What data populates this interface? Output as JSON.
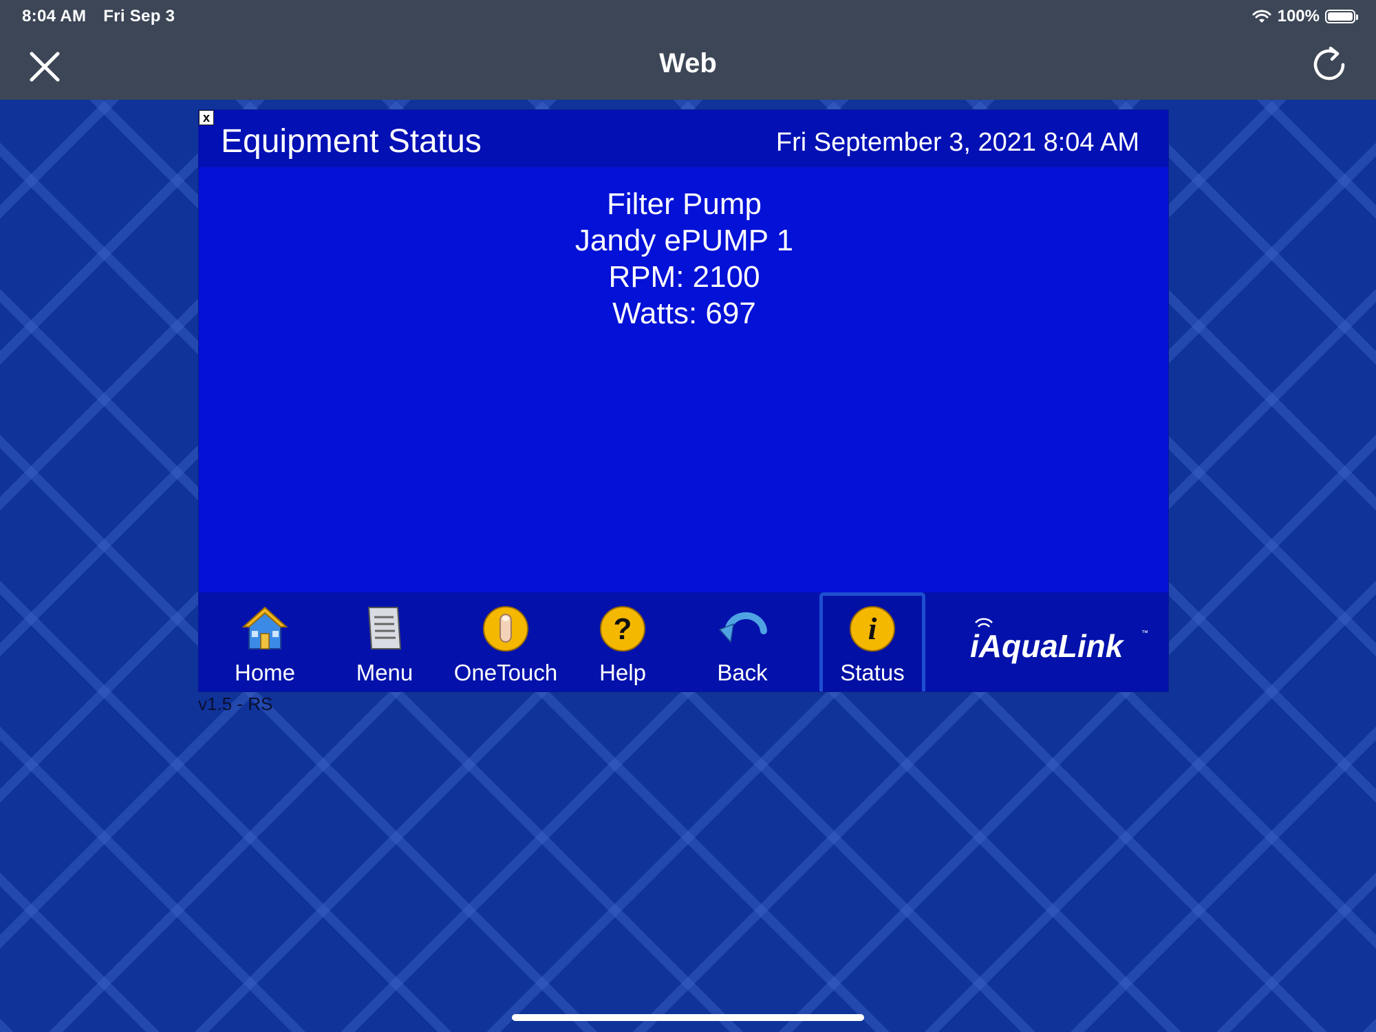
{
  "status_bar": {
    "time": "8:04 AM",
    "date": "Fri Sep 3",
    "battery": "100%",
    "icons": [
      "wifi-icon",
      "battery-icon"
    ]
  },
  "nav_bar": {
    "title": "Web",
    "icons": [
      "close-icon",
      "reload-icon"
    ]
  },
  "panel": {
    "close_label": "x",
    "title": "Equipment Status",
    "datetime": "Fri September 3, 2021 8:04 AM",
    "details": [
      "Filter Pump",
      "Jandy ePUMP 1",
      "RPM: 2100",
      "Watts: 697"
    ]
  },
  "toolbar": {
    "buttons": [
      {
        "label": "Home",
        "icon": "home-icon"
      },
      {
        "label": "Menu",
        "icon": "menu-icon"
      },
      {
        "label": "OneTouch",
        "icon": "onetouch-icon"
      },
      {
        "label": "Help",
        "icon": "help-icon"
      },
      {
        "label": "Back",
        "icon": "back-icon"
      },
      {
        "label": "Status",
        "icon": "status-icon",
        "active": true
      }
    ],
    "brand": "iAquaLink"
  },
  "footer": {
    "version": "v1.5 - RS"
  },
  "colors": {
    "panel_bg": "#0411d6",
    "header_bg": "#0310b4",
    "toolbar_bg": "#0412ab",
    "page_bg": "#10339a",
    "topbar_bg": "#3c4657",
    "icon_yellow": "#f5b800"
  }
}
